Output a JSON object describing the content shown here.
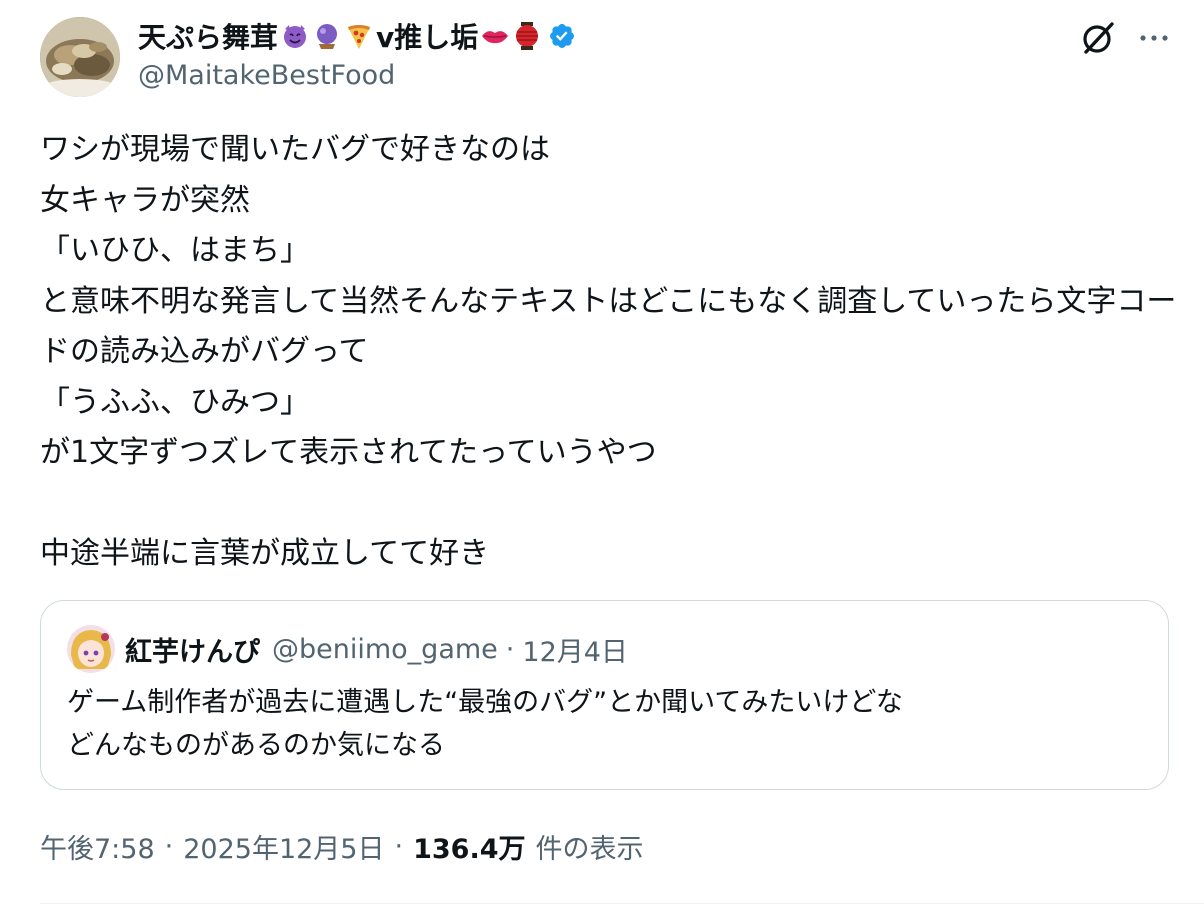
{
  "author": {
    "display_name": "天ぷら舞茸",
    "name_suffix": "v推し垢",
    "handle": "@MaitakeBestFood",
    "name_emojis": [
      "smiling-imp-emoji",
      "crystal-ball-emoji",
      "pizza-emoji"
    ],
    "suffix_emojis": [
      "lips-emoji",
      "lantern-emoji"
    ],
    "verified_color": "#1d9bf0"
  },
  "tweet": {
    "text": "ワシが現場で聞いたバグで好きなのは\n女キャラが突然\n「いひひ、はまち」\nと意味不明な発言して当然そんなテキストはどこにもなく調査していったら文字コードの読み込みがバグって\n「うふふ、ひみつ」\nが1文字ずつズレて表示されてたっていうやつ\n\n中途半端に言葉が成立してて好き"
  },
  "quote": {
    "display_name": "紅芋けんぴ",
    "handle": "@beniimo_game",
    "separator": "·",
    "date": "12月4日",
    "text": "ゲーム制作者が過去に遭遇した“最強のバグ”とか聞いてみたいけどな\nどんなものがあるのか気になる"
  },
  "meta": {
    "time": "午後7:58",
    "separator": "·",
    "date": "2025年12月5日",
    "views_count": "136.4万",
    "views_label": "件の表示"
  },
  "colors": {
    "text": "#0f1419",
    "secondary": "#536471",
    "border": "#cfd9de"
  }
}
